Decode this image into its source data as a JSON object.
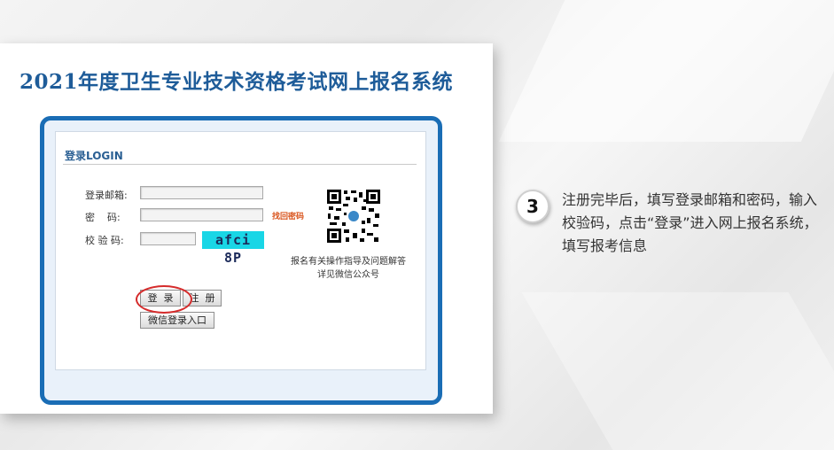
{
  "page": {
    "title": "2021年度卫生专业技术资格考试网上报名系统"
  },
  "login_panel": {
    "heading": "登录LOGIN",
    "email_label": "登录邮箱:",
    "email_value": "",
    "password_label": "密    码:",
    "password_value": "",
    "captcha_label": "校 验 码:",
    "captcha_value": "",
    "captcha_image_text": "afci 8P",
    "forgot_password": "找回密码",
    "qr_note_line1": "报名有关操作指导及问题解答",
    "qr_note_line2": "详见微信公众号",
    "login_button": "登  录",
    "register_button": "注  册",
    "wechat_login_button": "微信登录入口"
  },
  "instruction": {
    "step_number": "3",
    "text": "注册完毕后，填写登录邮箱和密码，输入校验码，点击“登录”进入网上报名系统，填写报考信息"
  },
  "colors": {
    "title": "#1e5c99",
    "frame_border": "#1a6db5",
    "captcha_bg": "#19d6e6",
    "highlight_ring": "#d52b2b",
    "forgot_link": "#d9541d"
  }
}
